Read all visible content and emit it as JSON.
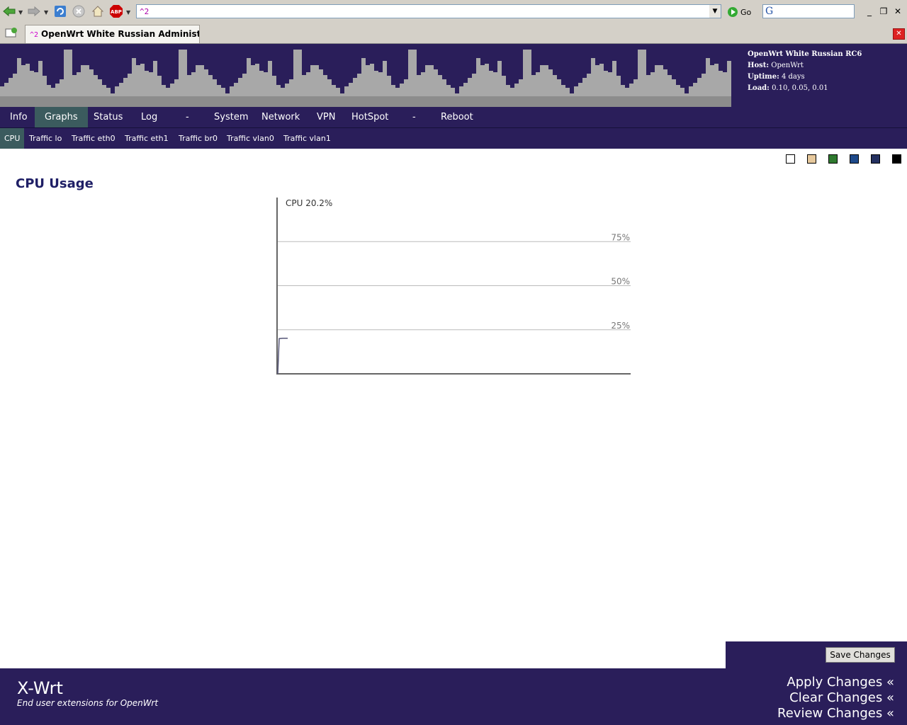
{
  "browser": {
    "address": "^2",
    "go_label": "Go",
    "tab_number": "^2",
    "tab_title": "OpenWrt White Russian Administrati..."
  },
  "header": {
    "version": "OpenWrt White Russian RC6",
    "host_label": "Host:",
    "host": "OpenWrt",
    "uptime_label": "Uptime:",
    "uptime": "4 days",
    "load_label": "Load:",
    "load": "0.10, 0.05, 0.01"
  },
  "nav": {
    "items": [
      "Info",
      "Graphs",
      "Status",
      "Log",
      "-",
      "System",
      "Network",
      "VPN",
      "HotSpot",
      "-",
      "Reboot"
    ],
    "active": "Graphs"
  },
  "subnav": {
    "items": [
      "CPU",
      "Traffic lo",
      "Traffic eth0",
      "Traffic eth1",
      "Traffic br0",
      "Traffic vlan0",
      "Traffic vlan1"
    ],
    "active": "CPU"
  },
  "theme_swatches": [
    "#ffffff",
    "#e6c89c",
    "#2f7a2f",
    "#1e4a8a",
    "#243060",
    "#000000"
  ],
  "page_title": "CPU Usage",
  "chart_data": {
    "type": "line",
    "title": "CPU 20.2%",
    "ylim": [
      0,
      100
    ],
    "y_ticks": [
      "75%",
      "50%",
      "25%"
    ],
    "series": [
      {
        "values": [
          0,
          20,
          20.2,
          20.2
        ]
      }
    ]
  },
  "buttons": {
    "save": "Save Changes"
  },
  "footer": {
    "brand": "X-Wrt",
    "tagline": "End user extensions for OpenWrt",
    "apply": "Apply Changes «",
    "clear": "Clear Changes «",
    "review": "Review Changes «"
  }
}
